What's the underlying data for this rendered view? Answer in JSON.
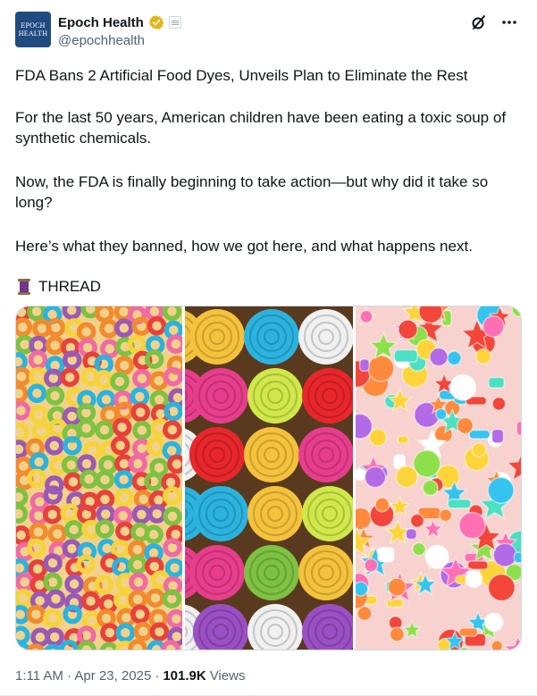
{
  "author": {
    "avatar_line1": "EPOCH",
    "avatar_line2": "HEALTH",
    "display_name": "Epoch Health",
    "handle": "@epochhealth"
  },
  "icons": {
    "verified": "gold-verified-badge-icon",
    "affiliate": "affiliate-badge-icon",
    "grok": "grok-icon",
    "more": "more-icon",
    "thread": "spool-emoji-icon"
  },
  "post": {
    "paragraphs": [
      "FDA Bans 2 Artificial Food Dyes, Unveils Plan to Eliminate the Rest",
      "For the last 50 years, American children have been eating a toxic soup of synthetic chemicals.",
      "Now, the FDA is finally beginning to take action—but why did it take so long?",
      "Here’s what they banned, how we got here, and what happens next."
    ],
    "thread_label": "THREAD"
  },
  "meta": {
    "timestamp": "1:11 AM · Apr 23, 2025",
    "separator": "·",
    "views_count": "101.9K",
    "views_label": "Views"
  },
  "colors": {
    "text_primary": "#0f1419",
    "text_secondary": "#536471",
    "verified_gold": "#e2b719",
    "avatar_bg": "#1f4b80"
  }
}
